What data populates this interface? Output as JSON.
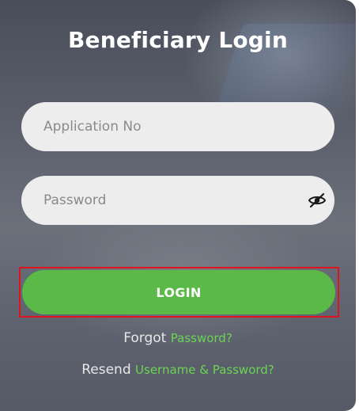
{
  "title": "Beneficiary Login",
  "application_no": {
    "placeholder": "Application No",
    "value": ""
  },
  "password": {
    "placeholder": "Password",
    "value": "",
    "toggle_icon": "eye-slash-icon"
  },
  "login_button": {
    "label": "LOGIN"
  },
  "forgot": {
    "prefix": "Forgot",
    "link": "Password?"
  },
  "resend": {
    "prefix": "Resend",
    "link": "Username & Password?"
  },
  "colors": {
    "accent": "#5ab947",
    "link": "#6cd454",
    "highlight_border": "#e0141c"
  }
}
